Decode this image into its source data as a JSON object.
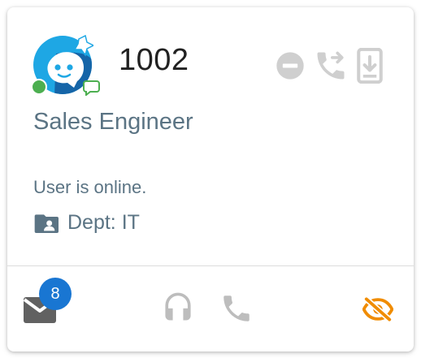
{
  "user": {
    "extension": "1002",
    "job_title": "Sales Engineer",
    "status_text": "User is online.",
    "department": "Dept: IT",
    "presence_color": "#4caf50"
  },
  "top_actions": [
    {
      "icon": "do-not-disturb-icon"
    },
    {
      "icon": "call-forward-icon"
    },
    {
      "icon": "mobile-download-icon"
    }
  ],
  "footer": {
    "voicemail_count": "8",
    "voicemail_icon": "mail-icon",
    "headset_icon": "headset-icon",
    "call_icon": "phone-icon",
    "hide_icon": "eye-off-icon"
  },
  "colors": {
    "muted_icon": "#cfcfcf",
    "secondary_text": "#5b7484",
    "badge": "#1976d2",
    "warning": "#f08c00"
  }
}
